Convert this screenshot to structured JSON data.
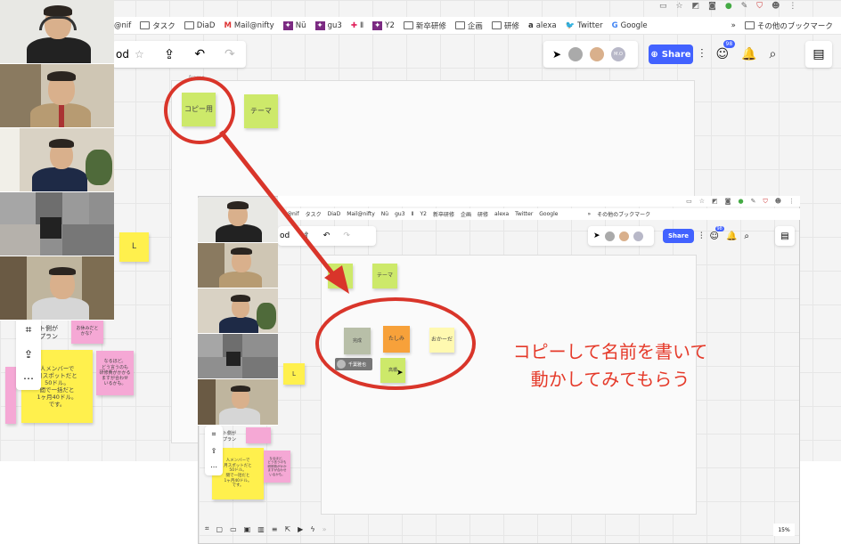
{
  "browser_bar": {
    "items": [
      "@nif",
      "タスク",
      "DiaD",
      "Mail@nifty",
      "Nü",
      "gu3",
      "Ⅱ",
      "Y2",
      "新卒研修",
      "企画",
      "研修",
      "alexa",
      "Twitter",
      "Google"
    ],
    "more": "»",
    "other": "その他のブックマーク"
  },
  "inset_browser_bar": {
    "items": [
      "@nif",
      "タスク",
      "DiaD",
      "Mail@nifty",
      "Nü",
      "gu3",
      "Ⅱ",
      "Y2",
      "新卒研修",
      "企画",
      "研修",
      "alexa",
      "Twitter",
      "Google"
    ],
    "more": "»",
    "other": "その他のブックマーク"
  },
  "board": {
    "title_fragment": "od",
    "share": "Share",
    "badge": "98",
    "avatar_initials": "M.O"
  },
  "inset_board": {
    "title_fragment": "od",
    "share": "Share",
    "badge": "98",
    "zoom": "15%"
  },
  "stickies": {
    "copy": "コピー用",
    "theme": "テーマ",
    "l": "L",
    "note1": "ト側が\nプラン",
    "note2": "お休みだと\nかな？",
    "note3": "人メンバーで\n月スポットだと\n50ドル。\n間で一括だと\n1ヶ月40ドル。\nです。",
    "note4": "なるほど。\nどう言うのも\n研修費がかかる\nますが合わせ\nいるかも。"
  },
  "inset_stickies": {
    "theme": "テーマ",
    "gray": "完成",
    "orange": "たしみ",
    "cream": "おかーだ",
    "lg2": "高橋",
    "name_tag": "千葉雅也",
    "l": "L",
    "note1": "ト側が\nプラン",
    "note3": "人メンバーで\n月スポットだと\n50ドル。\n間で一括だと\n1ヶ月40ドル。\nです。",
    "note4": "なるほど、\nどう言うのも\n研修費がかか\nますが合わせ\nいるかも。"
  },
  "annotation": {
    "line1": "コピーして名前を書いて",
    "line2": "動かしてみてもらう"
  },
  "colors": {
    "accent": "#e53a2a",
    "share": "#4262ff",
    "arrow": "#d9352a"
  }
}
